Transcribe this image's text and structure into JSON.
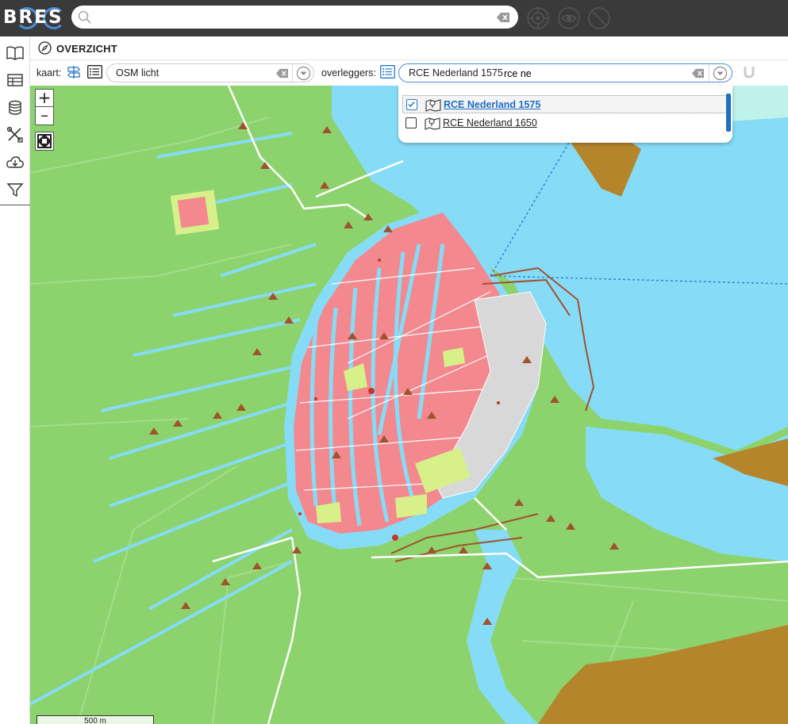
{
  "app": {
    "logo_text": "BRES",
    "search_placeholder": ""
  },
  "sidebar": {
    "items": [
      "book-icon",
      "table-icon",
      "database-icon",
      "tools-icon",
      "cloud-download-icon",
      "filter-icon"
    ]
  },
  "header": {
    "title": "OVERZICHT"
  },
  "toolbar": {
    "map_label": "kaart:",
    "basemap_value": "OSM licht",
    "overlays_label": "overleggers:",
    "overlay_selected": "RCE Nederland 1575",
    "overlay_search_value": "rce ne"
  },
  "dropdown": {
    "items": [
      {
        "label": "RCE Nederland 1575",
        "checked": true
      },
      {
        "label": "RCE Nederland 1650",
        "checked": false
      }
    ]
  },
  "map": {
    "zoom_in": "+",
    "zoom_out": "–",
    "scale_label": "500 m",
    "colors": {
      "land": "#8cd36d",
      "water": "#86dcf6",
      "city": "#f3888f",
      "brown": "#b5852c"
    }
  }
}
